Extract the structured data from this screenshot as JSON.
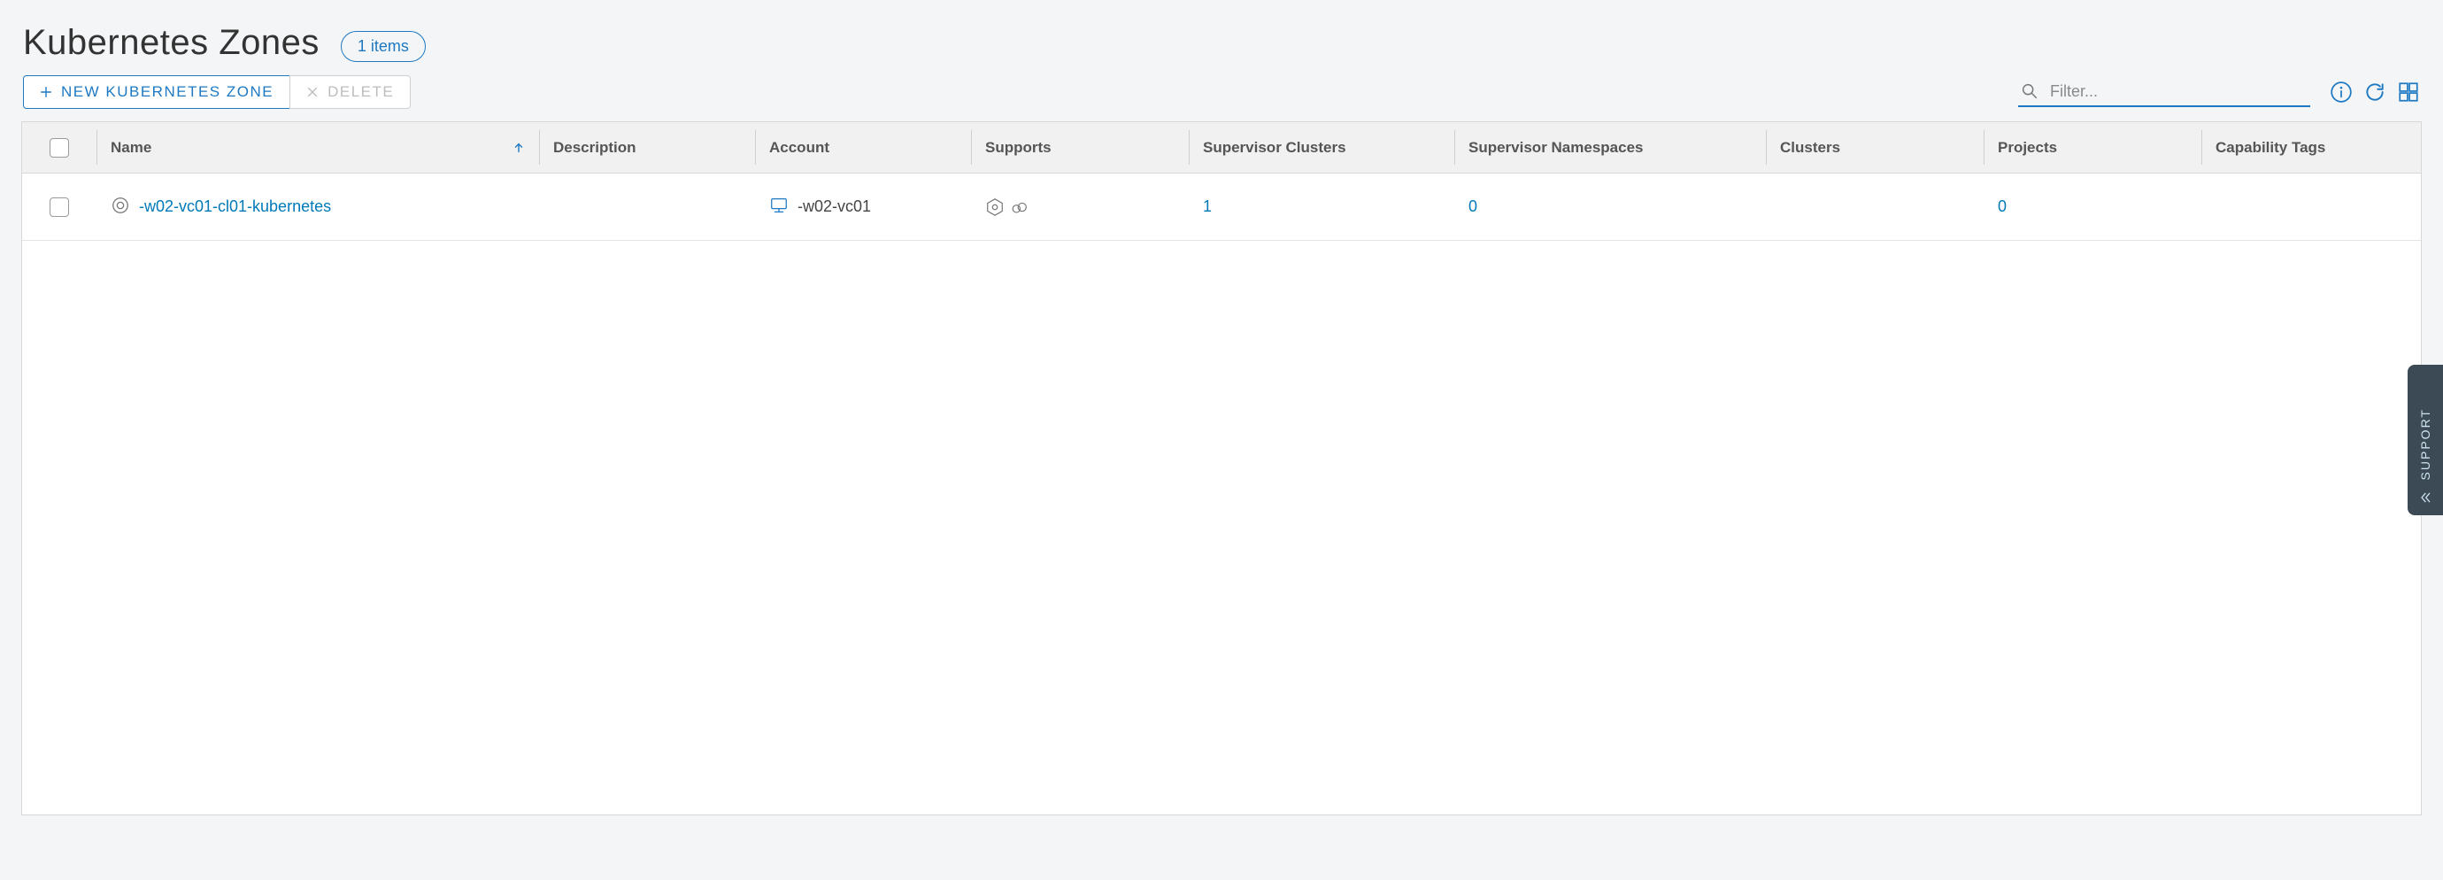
{
  "header": {
    "title": "Kubernetes Zones",
    "count_label": "1 items"
  },
  "toolbar": {
    "new_label": "NEW KUBERNETES ZONE",
    "delete_label": "DELETE",
    "filter_placeholder": "Filter..."
  },
  "columns": {
    "name": "Name",
    "description": "Description",
    "account": "Account",
    "supports": "Supports",
    "supervisor_clusters": "Supervisor Clusters",
    "supervisor_namespaces": "Supervisor Namespaces",
    "clusters": "Clusters",
    "projects": "Projects",
    "capability_tags": "Capability Tags"
  },
  "rows": [
    {
      "name": "-w02-vc01-cl01-kubernetes",
      "description": "",
      "account": "-w02-vc01",
      "supports": "",
      "supervisor_clusters": "1",
      "supervisor_namespaces": "0",
      "clusters": "",
      "projects": "0",
      "capability_tags": ""
    }
  ],
  "support_tab": {
    "label": "SUPPORT"
  }
}
